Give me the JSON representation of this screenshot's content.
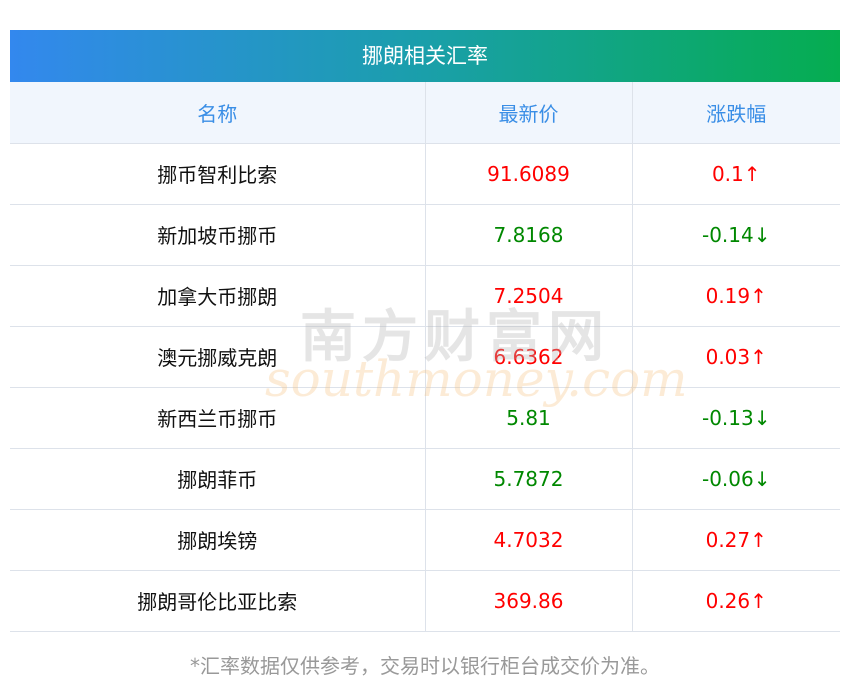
{
  "title": "挪朗相关汇率",
  "columns": [
    "名称",
    "最新价",
    "涨跌幅"
  ],
  "rows": [
    {
      "name": "挪币智利比索",
      "price": "91.6089",
      "change": "0.1↑",
      "dir": "up"
    },
    {
      "name": "新加坡币挪币",
      "price": "7.8168",
      "change": "-0.14↓",
      "dir": "down"
    },
    {
      "name": "加拿大币挪朗",
      "price": "7.2504",
      "change": "0.19↑",
      "dir": "up"
    },
    {
      "name": "澳元挪威克朗",
      "price": "6.6362",
      "change": "0.03↑",
      "dir": "up"
    },
    {
      "name": "新西兰币挪币",
      "price": "5.81",
      "change": "-0.13↓",
      "dir": "down"
    },
    {
      "name": "挪朗菲币",
      "price": "5.7872",
      "change": "-0.06↓",
      "dir": "down"
    },
    {
      "name": "挪朗埃镑",
      "price": "4.7032",
      "change": "0.27↑",
      "dir": "up"
    },
    {
      "name": "挪朗哥伦比亚比索",
      "price": "369.86",
      "change": "0.26↑",
      "dir": "up"
    }
  ],
  "footer": "*汇率数据仅供参考，交易时以银行柜台成交价为准。",
  "watermark": {
    "cn": "南方财富网",
    "en": "southmoney.com"
  },
  "colors": {
    "up": "#ff0000",
    "down": "#008800",
    "header_text": "#3a8ee6"
  }
}
